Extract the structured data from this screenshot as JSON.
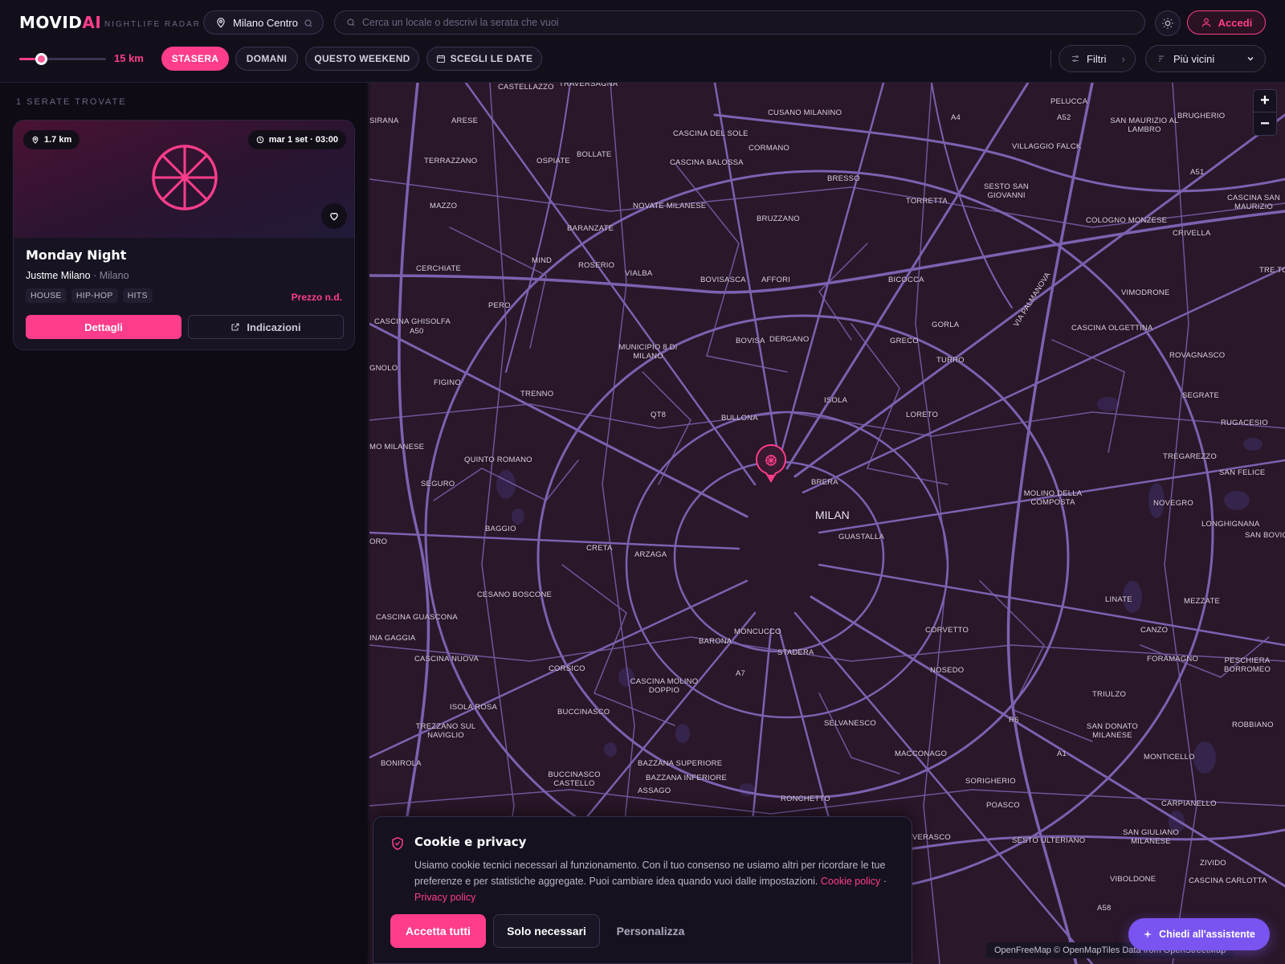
{
  "header": {
    "logo_main": "MOVID",
    "logo_accent": "AI",
    "tagline": "NIGHTLIFE RADAR",
    "location": "Milano Centro",
    "search_placeholder": "Cerca un locale o descrivi la serata che vuoi",
    "login_label": "Accedi"
  },
  "filters": {
    "radius_label": "15 km",
    "radius_fraction": 0.25,
    "date_pills": [
      {
        "label": "STASERA",
        "active": true
      },
      {
        "label": "DOMANI",
        "active": false
      },
      {
        "label": "QUESTO WEEKEND",
        "active": false
      },
      {
        "label": "SCEGLI LE DATE",
        "active": false
      }
    ],
    "filter_label": "Filtri",
    "sort_label": "Più vicini"
  },
  "results": {
    "count_label": "1 SERATE TROVATE",
    "events": [
      {
        "distance": "1.7 km",
        "datetime": "mar 1 set · 03:00",
        "title": "Monday Night",
        "venue": "Justme Milano",
        "city": "· Milano",
        "tags": [
          "HOUSE",
          "HIP-HOP",
          "HITS"
        ],
        "price": "Prezzo n.d.",
        "details_label": "Dettagli",
        "directions_label": "Indicazioni"
      }
    ]
  },
  "map": {
    "city_label": "MILAN",
    "places": [
      "CASTELLAZZO",
      "TRAVERSAGNA",
      "CUSANO MILANINO",
      "PELUCCA",
      "SAN MAURIZIO AL LAMBRO",
      "BRUGHERIO",
      "SIRANA",
      "ARESE",
      "CASCINA DEL SOLE",
      "CORMANO",
      "VILLAGGIO FALCK",
      "TERRAZZANO",
      "OSPIATE",
      "BOLLATE",
      "CASCINA BALOSSA",
      "BRESSO",
      "SESTO SAN GIOVANNI",
      "CASCINA SAN MAURIZIO",
      "MAZZO",
      "NOVATE MILANESE",
      "TORRETTA",
      "COLOGNO MONZESE",
      "BARANZATE",
      "BRUZZANO",
      "CRIVELLA",
      "MIND",
      "ROSERIO",
      "VIALBA",
      "CERCHIATE",
      "BOVISASCA",
      "AFFORI",
      "BICOCCA",
      "TRE TO",
      "VIMODRONE",
      "PERO",
      "CASCINA GHISOLFA",
      "CASCINA OLGETTINA",
      "GORLA",
      "BOVISA",
      "DERGANO",
      "GRECO",
      "MUNICIPIO 8 DI MILANO",
      "TURRO",
      "ROVAGNASCO",
      "GNOLO",
      "FIGINO",
      "TRENNO",
      "ISOLA",
      "SEGRATE",
      "QT8",
      "BULLONA",
      "LORETO",
      "RUGACESIO",
      "MO MILANESE",
      "QUINTO ROMANO",
      "TREGAREZZO",
      "SAN FELICE",
      "SEGURO",
      "BRERA",
      "MOLINO DELLA COMPOSTA",
      "NOVEGRO",
      "BAGGIO",
      "GUASTALLA",
      "LONGHIGNANA",
      "ORO",
      "CRETA",
      "ARZAGA",
      "SAN BOVIO",
      "CESANO BOSCONE",
      "LINATE",
      "MEZZATE",
      "CASCINA GUASCONA",
      "INA GAGGIA",
      "MONCUCCO",
      "CORVETTO",
      "CANZO",
      "BARONA",
      "STADERA",
      "CASCINA NUOVA",
      "NOSEDO",
      "FORAMAGNO",
      "PESCHIERA BORROMEO",
      "CORSICO",
      "CASCINA MOLINO DOPPIO",
      "TRIULZO",
      "ISOLA ROSA",
      "BUCCINASCO",
      "SELVANESCO",
      "ROBBIANO",
      "TREZZANO SUL NAVIGLIO",
      "SAN DONATO MILANESE",
      "MONTICELLO",
      "BONIROLA",
      "MACCONAGO",
      "BAZZANA SUPERIORE",
      "BAZZANA INFERIORE",
      "BUCCINASCO CASTELLO",
      "SORIGHERIO",
      "ASSAGO",
      "RONCHETTO",
      "POASCO",
      "CARPIANELLO",
      "VERASCO",
      "SESTO ULTERIANO",
      "SAN GIULIANO MILANESE",
      "ZIVIDO",
      "VIBOLDONE",
      "CASCINA CARLOTTA",
      "VIA PALMANOVA",
      "A4",
      "A52",
      "A50",
      "A51",
      "A7",
      "A1",
      "R6",
      "A58"
    ],
    "attribution": "OpenFreeMap © OpenMapTiles Data from OpenStreetMap",
    "zoom_in": "+",
    "zoom_out": "−",
    "assistant_label": "Chiedi all'assistente"
  },
  "cookie": {
    "title": "Cookie e privacy",
    "text": "Usiamo cookie tecnici necessari al funzionamento. Con il tuo consenso ne usiamo altri per ricordare le tue preferenze e per statistiche aggregate. Puoi cambiare idea quando vuoi dalle impostazioni.",
    "cookie_policy": "Cookie policy",
    "separator": "·",
    "privacy_policy": "Privacy policy",
    "accept_label": "Accetta tutti",
    "necessary_label": "Solo necessari",
    "customize_label": "Personalizza"
  },
  "colors": {
    "accent": "#ff3d8b",
    "assistant": "#7a54f0",
    "map_bg": "#2a1729",
    "roads": "#7b62b0"
  }
}
